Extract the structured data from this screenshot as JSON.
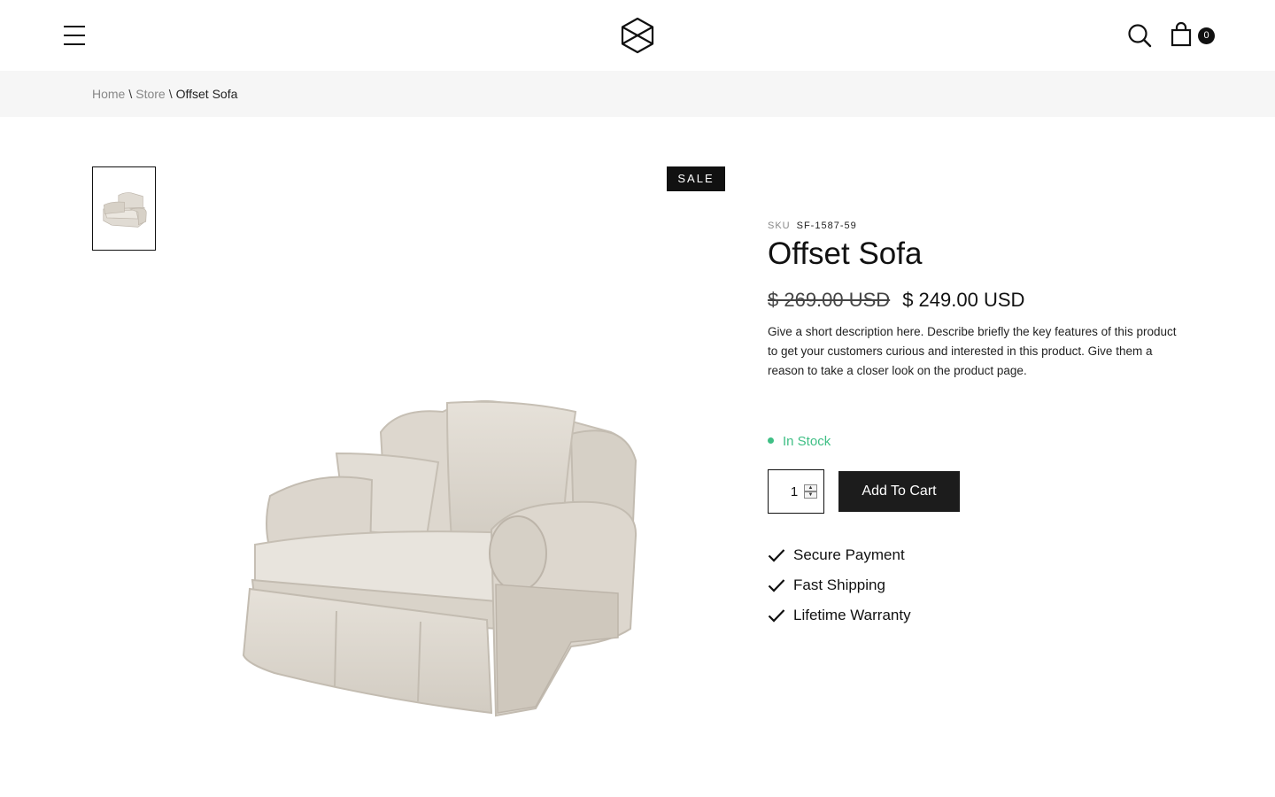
{
  "header": {
    "menu_icon": "hamburger-menu-icon",
    "logo_icon": "cube-logo-icon",
    "search_icon": "search-icon",
    "cart_icon": "shopping-bag-icon",
    "cart_count": "0"
  },
  "breadcrumb": {
    "items": [
      "Home",
      "Store"
    ],
    "separator": "\\",
    "current": "Offset Sofa"
  },
  "gallery": {
    "badge": "SALE",
    "image_subject": "beige upholstered armchair with two cushions"
  },
  "product": {
    "sku_label": "SKU",
    "sku": "SF-1587-59",
    "title": "Offset Sofa",
    "old_price": "$ 269.00 USD",
    "price": "$ 249.00 USD",
    "description": "Give a short description here. Describe briefly the key features of this product to get your customers curious and interested in this product. Give them a reason to take a closer look on the product page.",
    "stock_status": "In Stock",
    "quantity": "1",
    "add_to_cart": "Add To Cart",
    "features": [
      "Secure Payment",
      "Fast Shipping",
      "Lifetime Warranty"
    ]
  },
  "colors": {
    "accent_dark": "#1c1c1c",
    "in_stock": "#3fbf85",
    "breadcrumb_bg": "#f6f6f6"
  }
}
